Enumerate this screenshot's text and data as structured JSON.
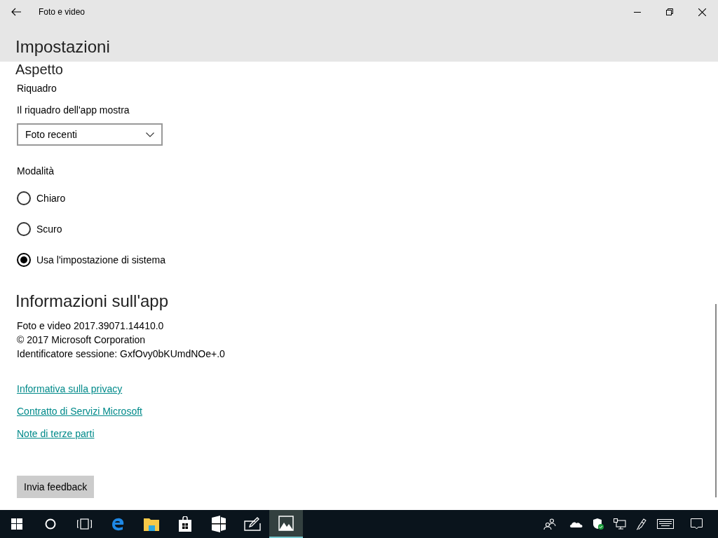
{
  "window": {
    "title": "Foto e video"
  },
  "page_title": "Impostazioni",
  "appearance": {
    "heading": "Aspetto",
    "tile_label": "Riquadro",
    "dropdown_label": "Il riquadro dell'app mostra",
    "dropdown_value": "Foto recenti",
    "mode_label": "Modalità",
    "modes": [
      {
        "label": "Chiaro",
        "selected": false
      },
      {
        "label": "Scuro",
        "selected": false
      },
      {
        "label": "Usa l'impostazione di sistema",
        "selected": true
      }
    ]
  },
  "about": {
    "heading": "Informazioni sull'app",
    "lines": [
      "Foto e video 2017.39071.14410.0",
      "© 2017 Microsoft Corporation",
      "Identificatore sessione: GxfOvy0bKUmdNOe+.0"
    ],
    "links": [
      "Informativa sulla privacy",
      "Contratto di Servizi Microsoft",
      "Note di terze parti"
    ],
    "feedback_button": "Invia feedback"
  },
  "taskbar": {
    "apps": [
      {
        "kind": "start",
        "selected": false
      },
      {
        "kind": "search",
        "selected": false
      },
      {
        "kind": "taskview",
        "selected": false
      },
      {
        "kind": "browser",
        "selected": false
      },
      {
        "kind": "folder",
        "selected": false
      },
      {
        "kind": "store",
        "selected": false
      },
      {
        "kind": "tablet",
        "selected": false
      },
      {
        "kind": "sketch",
        "selected": false
      },
      {
        "kind": "photos",
        "selected": true
      }
    ]
  }
}
